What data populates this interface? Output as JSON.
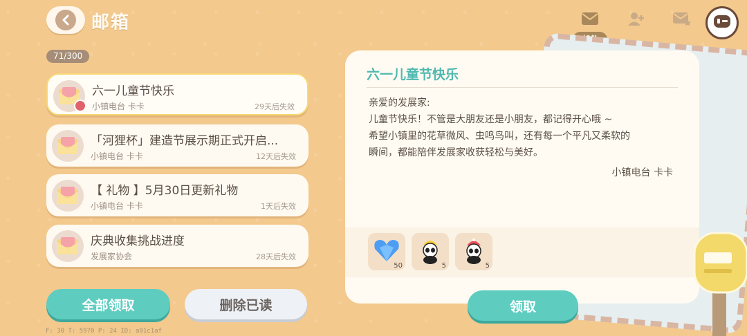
{
  "header": {
    "title": "邮箱",
    "count": "71/300"
  },
  "tabs": [
    {
      "icon": "mail-icon",
      "label": "邮件"
    },
    {
      "icon": "add-friend-icon"
    },
    {
      "icon": "starred-mail-icon"
    }
  ],
  "mails": [
    {
      "title": "六一儿童节快乐",
      "sender": "小镇电台 卡卡",
      "expire": "29天后失效"
    },
    {
      "title": "「河狸杯」建造节展示期正式开启...",
      "sender": "小镇电台 卡卡",
      "expire": "12天后失效"
    },
    {
      "title": "【 礼物 】5月30日更新礼物",
      "sender": "小镇电台 卡卡",
      "expire": "1天后失效"
    },
    {
      "title": "庆典收集挑战进度",
      "sender": "发展家协会",
      "expire": "28天后失效"
    }
  ],
  "actions": {
    "claim_all": "全部领取",
    "delete_read": "删除已读",
    "claim": "领取"
  },
  "detail": {
    "title": "六一儿童节快乐",
    "greeting": "亲爱的发展家:",
    "line1": "儿童节快乐！不管是大朋友还是小朋友，都记得开心哦 ~",
    "line2": "希望小镇里的花草微风、虫鸣鸟叫，还有每一个平凡又柔软的",
    "line3": "瞬间，都能陪伴发展家收获轻松与美好。",
    "signature": "小镇电台 卡卡",
    "rewards": [
      {
        "icon": "blue-heart-crystal-icon",
        "qty": "50"
      },
      {
        "icon": "panda-yellow-hat-icon",
        "qty": "5"
      },
      {
        "icon": "panda-pink-hat-icon",
        "qty": "5"
      }
    ]
  },
  "debug": "F: 30    T: 5970    P: 24    ID: a01c1af"
}
